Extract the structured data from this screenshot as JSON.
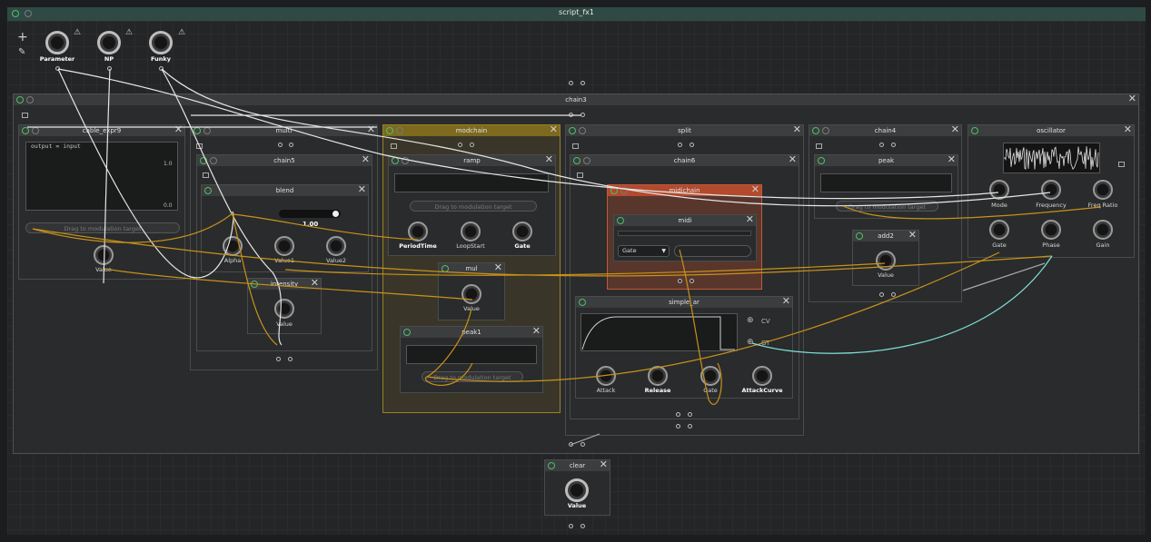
{
  "window": {
    "title": "script_fx1"
  },
  "params": [
    {
      "label": "Parameter"
    },
    {
      "label": "NP"
    },
    {
      "label": "Funky"
    }
  ],
  "nodes": {
    "chain3": {
      "title": "chain3"
    },
    "cable": {
      "title": "cable_expr9",
      "code_var": "output",
      "code_op": "=",
      "code_val": "input",
      "max": "1.0",
      "min": "0.0",
      "drag": "Drag to modulation target",
      "value_label": "Value"
    },
    "multi": {
      "title": "multi"
    },
    "chain5": {
      "title": "chain5"
    },
    "blend": {
      "title": "blend",
      "value": "1.00",
      "knobs": [
        "Alpha",
        "Value1",
        "Value2"
      ]
    },
    "intensity": {
      "title": "intensity",
      "value_label": "Value"
    },
    "modchain": {
      "title": "modchain"
    },
    "ramp": {
      "title": "ramp",
      "drag": "Drag to modulation target",
      "knobs": [
        "PeriodTime",
        "LoopStart",
        "Gate"
      ]
    },
    "mul": {
      "title": "mul",
      "value_label": "Value"
    },
    "peak1": {
      "title": "peak1",
      "drag": "Drag to modulation target"
    },
    "split": {
      "title": "split"
    },
    "chain6": {
      "title": "chain6"
    },
    "midichain": {
      "title": "midichain"
    },
    "midi": {
      "title": "midi",
      "mode": "Gate"
    },
    "simple_ar": {
      "title": "simple_ar",
      "cv": "CV",
      "gt": "GT",
      "knobs": [
        "Attack",
        "Release",
        "Gate",
        "AttackCurve"
      ]
    },
    "chain4": {
      "title": "chain4"
    },
    "peak": {
      "title": "peak",
      "drag": "Drag to modulation target"
    },
    "add2": {
      "title": "add2",
      "value_label": "Value"
    },
    "oscillator": {
      "title": "oscillator",
      "knobs": [
        "Mode",
        "Frequency",
        "Freq Ratio",
        "Gate",
        "Phase",
        "Gain"
      ]
    },
    "clear": {
      "title": "clear",
      "value_label": "Value"
    }
  },
  "colors": {
    "accent_green": "#4cc06a",
    "modchain": "#7d6a1e",
    "midichain": "#b24a2e",
    "wire_white": "#e6e6e6",
    "wire_orange": "#c8921a",
    "wire_cyan": "#7fe0d8",
    "header_teal": "#2f4a44"
  }
}
